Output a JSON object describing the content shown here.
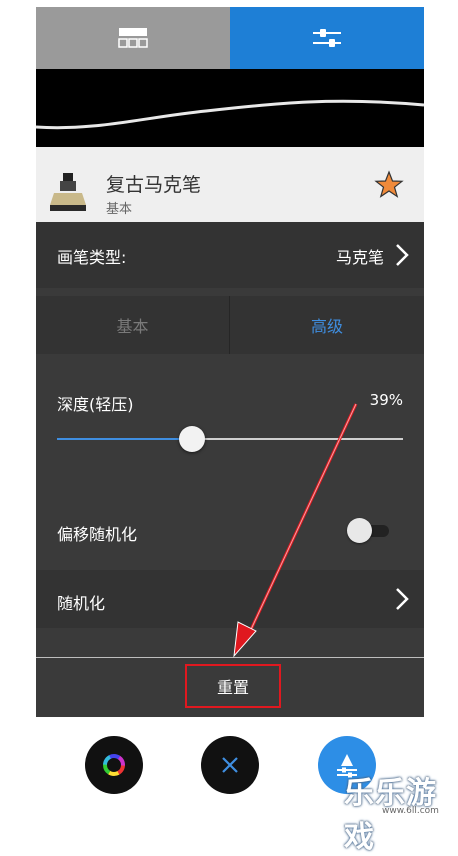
{
  "tabs": [
    {
      "icon": "grid-icon",
      "active": false
    },
    {
      "icon": "sliders-icon",
      "active": true
    }
  ],
  "brush": {
    "name": "复古马克笔",
    "category": "基本",
    "favorite_icon": "star-icon"
  },
  "brush_type": {
    "label": "画笔类型:",
    "value": "马克笔"
  },
  "segments": {
    "basic": "基本",
    "advanced": "高级",
    "selected": "advanced"
  },
  "depth": {
    "label": "深度(轻压)",
    "value_text": "39%",
    "value": 0.39
  },
  "offset_random": {
    "label": "偏移随机化",
    "enabled": false
  },
  "randomize": {
    "label": "随机化"
  },
  "reset_label": "重置",
  "fabs": [
    {
      "icon": "color-wheel-icon"
    },
    {
      "icon": "close-icon"
    },
    {
      "icon": "brush-settings-icon"
    }
  ],
  "watermark": {
    "text": "乐乐游戏",
    "url": "www.6ll.com"
  },
  "colors": {
    "accent": "#1e7fd6",
    "panel": "#333333",
    "highlight": "#e0181f"
  }
}
